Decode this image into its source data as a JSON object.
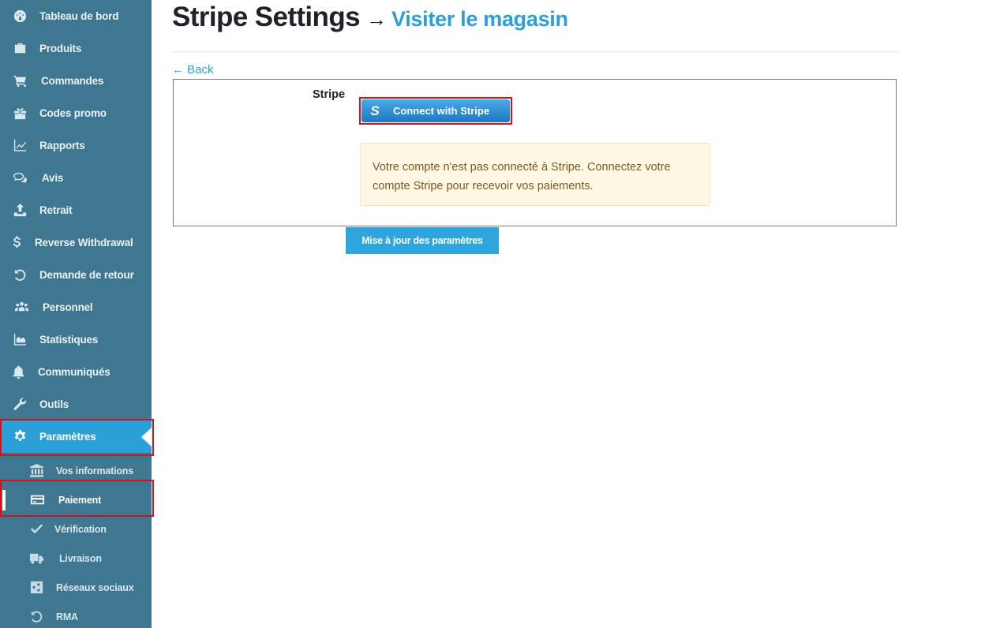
{
  "sidebar": {
    "items": [
      {
        "label": "Tableau de bord",
        "icon": "dashboard-icon"
      },
      {
        "label": "Produits",
        "icon": "briefcase-icon"
      },
      {
        "label": "Commandes",
        "icon": "cart-icon"
      },
      {
        "label": "Codes promo",
        "icon": "gift-icon"
      },
      {
        "label": "Rapports",
        "icon": "line-chart-icon"
      },
      {
        "label": "Avis",
        "icon": "comments-icon"
      },
      {
        "label": "Retrait",
        "icon": "upload-icon"
      },
      {
        "label": "Reverse Withdrawal",
        "icon": "dollar-icon"
      },
      {
        "label": "Demande de retour",
        "icon": "undo-icon"
      },
      {
        "label": "Personnel",
        "icon": "users-icon"
      },
      {
        "label": "Statistiques",
        "icon": "area-chart-icon"
      },
      {
        "label": "Communiqués",
        "icon": "bell-icon"
      },
      {
        "label": "Outils",
        "icon": "wrench-icon"
      },
      {
        "label": "Paramètres",
        "icon": "gear-icon"
      }
    ],
    "subitems": [
      {
        "label": "Vos informations",
        "icon": "bank-icon"
      },
      {
        "label": "Paiement",
        "icon": "credit-card-icon"
      },
      {
        "label": "Vérification",
        "icon": "check-icon"
      },
      {
        "label": "Livraison",
        "icon": "truck-icon"
      },
      {
        "label": "Réseaux sociaux",
        "icon": "share-icon"
      },
      {
        "label": "RMA",
        "icon": "undo-icon"
      }
    ],
    "active_item": "Paramètres",
    "current_subitem": "Paiement"
  },
  "header": {
    "title": "Stripe Settings",
    "arrow": "→",
    "visit_link": "Visiter le magasin"
  },
  "back_link": "← Back",
  "stripe": {
    "field_label": "Stripe",
    "connect_button": "Connect with Stripe",
    "connect_logo": "S",
    "notice": "Votre compte n'est pas connecté à Stripe. Connectez votre compte Stripe pour recevoir vos paiements."
  },
  "update_button": "Mise à jour des paramètres",
  "colors": {
    "sidebar_bg": "#3f7790",
    "accent": "#2a9fd8",
    "highlight_border": "#d1141b",
    "notice_bg": "#fdf7e3",
    "notice_text": "#7c5b22"
  }
}
